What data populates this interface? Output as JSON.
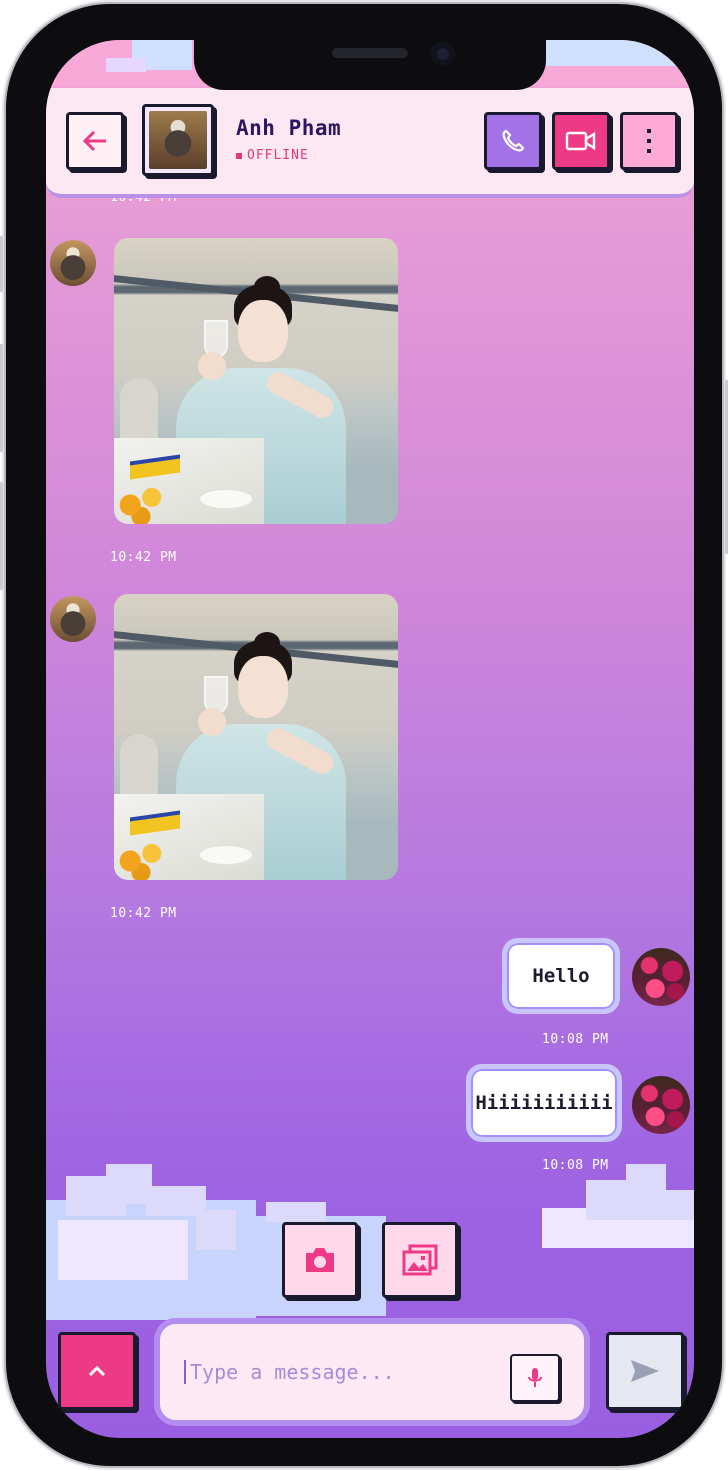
{
  "header": {
    "contact_name": "Anh Pham",
    "status": "OFFLINE",
    "back_icon": "arrow-left-icon",
    "call_icon": "phone-icon",
    "video_icon": "video-camera-icon",
    "menu_icon": "more-vertical-icon"
  },
  "messages": [
    {
      "type": "timestamp-cut",
      "time": "10:42 PM"
    },
    {
      "type": "image",
      "from": "contact",
      "time": "10:42 PM"
    },
    {
      "type": "image",
      "from": "contact",
      "time": "10:42 PM"
    },
    {
      "type": "text",
      "from": "me",
      "text": "Hello",
      "time": "10:08 PM"
    },
    {
      "type": "text",
      "from": "me",
      "text": "Hiiiiiiiiiii",
      "time": "10:08 PM"
    }
  ],
  "actions": {
    "camera_icon": "camera-icon",
    "gallery_icon": "gallery-icon"
  },
  "composer": {
    "placeholder": "Type a message...",
    "mic_icon": "microphone-icon",
    "send_icon": "send-icon",
    "expand_icon": "chevron-up-icon"
  },
  "colors": {
    "accent_pink": "#ee3a86",
    "accent_purple": "#a272e6",
    "status_red": "#e23a74",
    "name_text": "#2b1760"
  }
}
